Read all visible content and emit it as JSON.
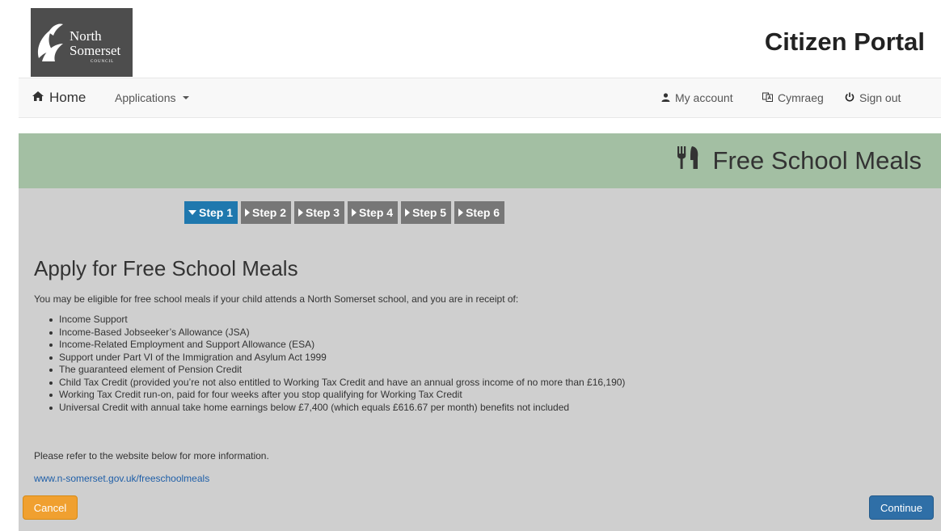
{
  "header": {
    "logo_line1": "North",
    "logo_line2": "Somerset",
    "logo_line3": "COUNCIL",
    "portal_title": "Citizen Portal"
  },
  "navbar": {
    "home_label": "Home",
    "applications_label": "Applications",
    "my_account_label": "My account",
    "cymraeg_label": "Cymraeg",
    "sign_out_label": "Sign out"
  },
  "panel": {
    "title": "Free School Meals",
    "steps": [
      {
        "label": "Step 1",
        "active": true
      },
      {
        "label": "Step 2",
        "active": false
      },
      {
        "label": "Step 3",
        "active": false
      },
      {
        "label": "Step 4",
        "active": false
      },
      {
        "label": "Step 5",
        "active": false
      },
      {
        "label": "Step 6",
        "active": false
      }
    ],
    "heading": "Apply for Free School Meals",
    "intro": "You may be eligible for free school meals if your child attends a North Somerset school, and you are in receipt of:",
    "criteria": [
      "Income Support",
      "Income-Based Jobseeker’s Allowance (JSA)",
      "Income-Related Employment and Support Allowance (ESA)",
      "Support under Part VI of the Immigration and Asylum Act 1999",
      "The guaranteed element of Pension Credit",
      "Child Tax Credit (provided you’re not also entitled to Working Tax Credit and have an annual gross income of no more than £16,190)",
      "Working Tax Credit run-on, paid for four weeks after you stop qualifying for Working Tax Credit",
      "Universal Credit with annual take home earnings below £7,400 (which equals £616.67 per month) benefits not included"
    ],
    "refer_text": "Please refer to the website below for more information.",
    "link_text": "www.n-somerset.gov.uk/freeschoolmeals",
    "cancel_label": "Cancel",
    "continue_label": "Continue"
  },
  "colors": {
    "header_band": "#a3bfa3",
    "active_step": "#1f78ae",
    "inactive_step": "#777777",
    "cancel_button": "#f0a030",
    "continue_button": "#2f6fa7"
  },
  "icons": {
    "home": "home-icon",
    "account": "user-icon",
    "language": "language-icon",
    "signout": "power-icon",
    "meals": "cutlery-icon"
  }
}
